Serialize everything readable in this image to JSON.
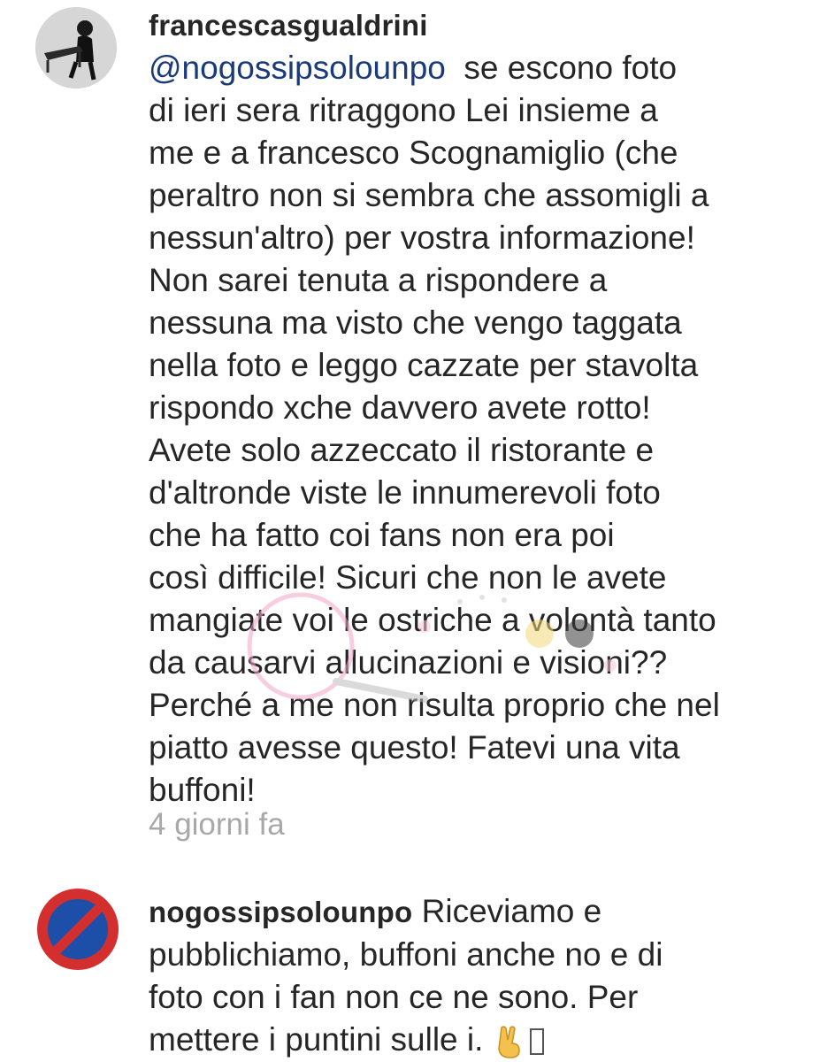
{
  "comments": [
    {
      "username": "francescasgualdrini",
      "mention": "@nogossipsolounpo",
      "lines": [
        "se escono foto",
        "di ieri sera ritraggono Lei insieme a",
        "me e a francesco Scognamiglio (che",
        "peraltro non si sembra che assomigli a",
        "nessun'altro) per vostra informazione!",
        "Non sarei tenuta a rispondere a",
        "nessuna ma visto che vengo taggata",
        "nella foto e leggo cazzate per stavolta",
        "rispondo xche davvero avete rotto!",
        "Avete solo azzeccato il ristorante e",
        "d'altronde viste le innumerevoli foto",
        "che ha fatto coi fans non era poi",
        "così difficile! Sicuri che non le avete",
        "mangiate voi le ostriche a volontà tanto",
        "da causarvi allucinazioni e visioni??",
        "Perché a me non risulta proprio che nel",
        "piatto avesse questo! Fatevi una vita",
        "buffoni!"
      ],
      "timestamp": "4 giorni fa"
    },
    {
      "username": "nogossipsolounpo",
      "lines": [
        "Riceviamo e",
        "pubblichiamo, buffoni anche no e di",
        "foto con i fan non ce ne sono. Per",
        "mettere i puntini sulle i."
      ],
      "emoji": "victory-hand"
    }
  ],
  "colors": {
    "text": "#262626",
    "timestamp": "#a8a8a8",
    "no_parking_red": "#d32f2f",
    "no_parking_blue": "#1e4fa8"
  }
}
